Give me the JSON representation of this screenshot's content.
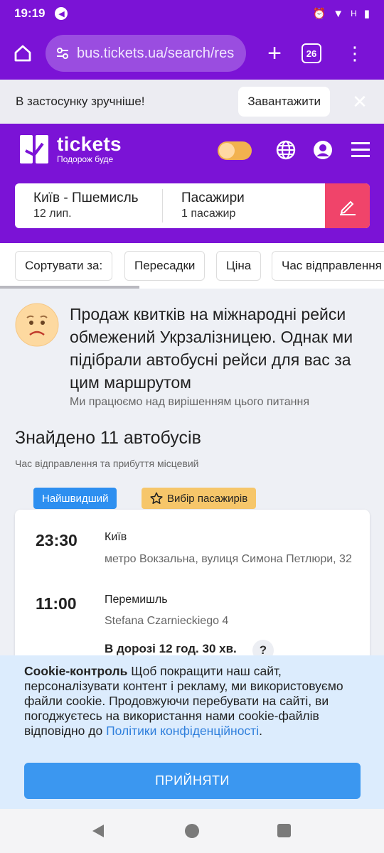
{
  "status_bar": {
    "time": "19:19",
    "network": "H"
  },
  "browser": {
    "url": "bus.tickets.ua/search/res",
    "tab_count": "26"
  },
  "app_banner": {
    "text": "В застосунку зручніше!",
    "download_label": "Завантажити"
  },
  "header": {
    "logo_name": "tickets",
    "logo_slogan": "Подорож буде",
    "route": "Київ - Пшемисль",
    "date": "12 лип.",
    "passengers_label": "Пасажири",
    "passengers_value": "1 пасажир",
    "accent_color": "#7b13d6",
    "edit_color": "#f0446a"
  },
  "sort_bar": {
    "label": "Сортувати за:",
    "options": [
      "Пересадки",
      "Ціна",
      "Час відправлення"
    ]
  },
  "notice": {
    "title": "Продаж квитків на міжнародні рейси обмежений Укрзалізницею. Однак ми підібрали автобусні рейси для вас за цим маршрутом",
    "subtitle": "Ми працюємо над вирішенням цього питання"
  },
  "results": {
    "found": "Знайдено 11 автобусів",
    "note": "Час відправлення та прибуття місцевий"
  },
  "trip": {
    "badge_fastest": "Найшвидший",
    "badge_choice": "Вибір пасажирів",
    "departure_time": "23:30",
    "departure_city": "Київ",
    "departure_address": "метро Вокзальна, вулиця Симона Петлюри, 32",
    "arrival_time": "11:00",
    "arrival_city": "Перемишль",
    "arrival_address": "Stefana Czarnieckiego 4",
    "duration": "В дорозі 12 год. 30 хв.",
    "help": "?"
  },
  "cookie": {
    "title": "Cookie-контроль",
    "text": "Щоб покращити наш сайт, персоналізувати контент і рекламу, ми використовуємо файли cookie. Продовжуючи перебувати на сайті, ви погоджуєтесь на використання нами cookie-файлів відповідно до",
    "link": "Політики конфіденційності",
    "end": ".",
    "accept_label": "ПРИЙНЯТИ"
  }
}
